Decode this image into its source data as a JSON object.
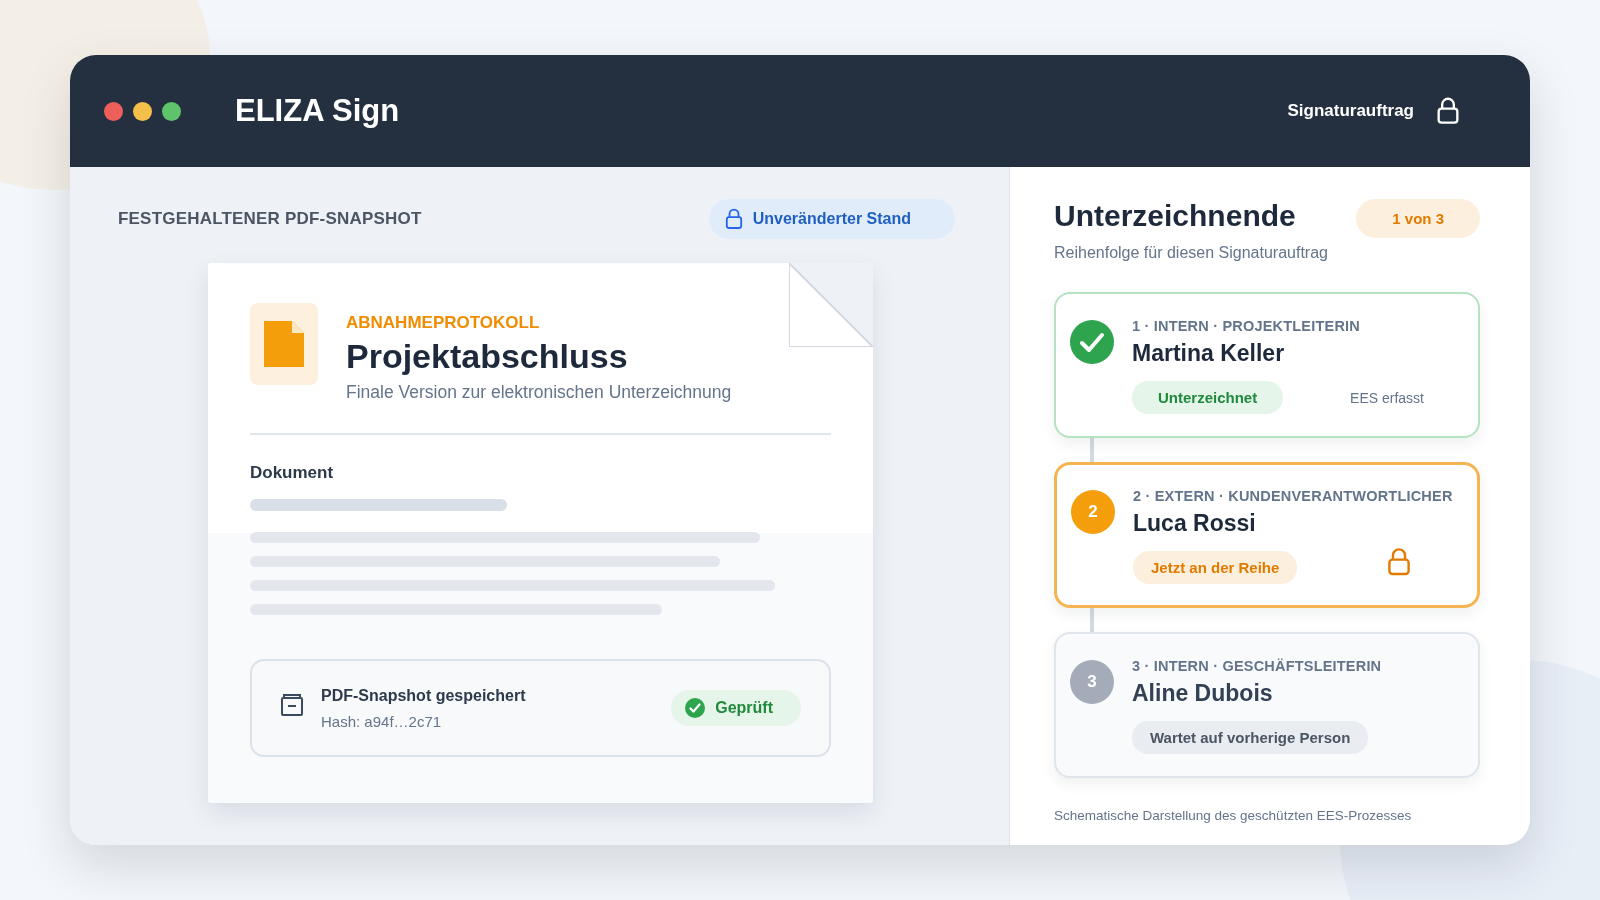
{
  "window": {
    "title": "ELIZA Sign",
    "header_label": "Signaturauftrag"
  },
  "snapshot": {
    "section_label": "FESTGEHALTENER PDF-SNAPSHOT",
    "status_pill": "Unveränderter Stand",
    "document": {
      "kicker": "ABNAHMEPROTOKOLL",
      "title": "Projektabschluss",
      "subtitle": "Finale Version zur elektronischen Unterzeichnung",
      "body_label": "Dokument",
      "saved": {
        "title": "PDF-Snapshot gespeichert",
        "hash": "Hash: a94f…2c71",
        "badge": "Geprüft"
      }
    }
  },
  "signers": {
    "title": "Unterzeichnende",
    "progress": "1 von 3",
    "subtitle": "Reihenfolge für diesen Signaturauftrag",
    "items": [
      {
        "kind": "signed",
        "role": "1 · INTERN · PROJEKTLEITERIN",
        "name": "Martina Keller",
        "status": "Unterzeichnet",
        "note": "EES erfasst"
      },
      {
        "kind": "current",
        "number": "2",
        "role": "2 · EXTERN · KUNDENVERANTWORTLICHER",
        "name": "Luca Rossi",
        "status": "Jetzt an der Reihe"
      },
      {
        "kind": "waiting",
        "number": "3",
        "role": "3 · INTERN · GESCHÄFTSLEITERIN",
        "name": "Aline Dubois",
        "status": "Wartet auf vorherige Person"
      }
    ],
    "footnote": "Schematische Darstellung des geschützten EES-Prozesses"
  }
}
